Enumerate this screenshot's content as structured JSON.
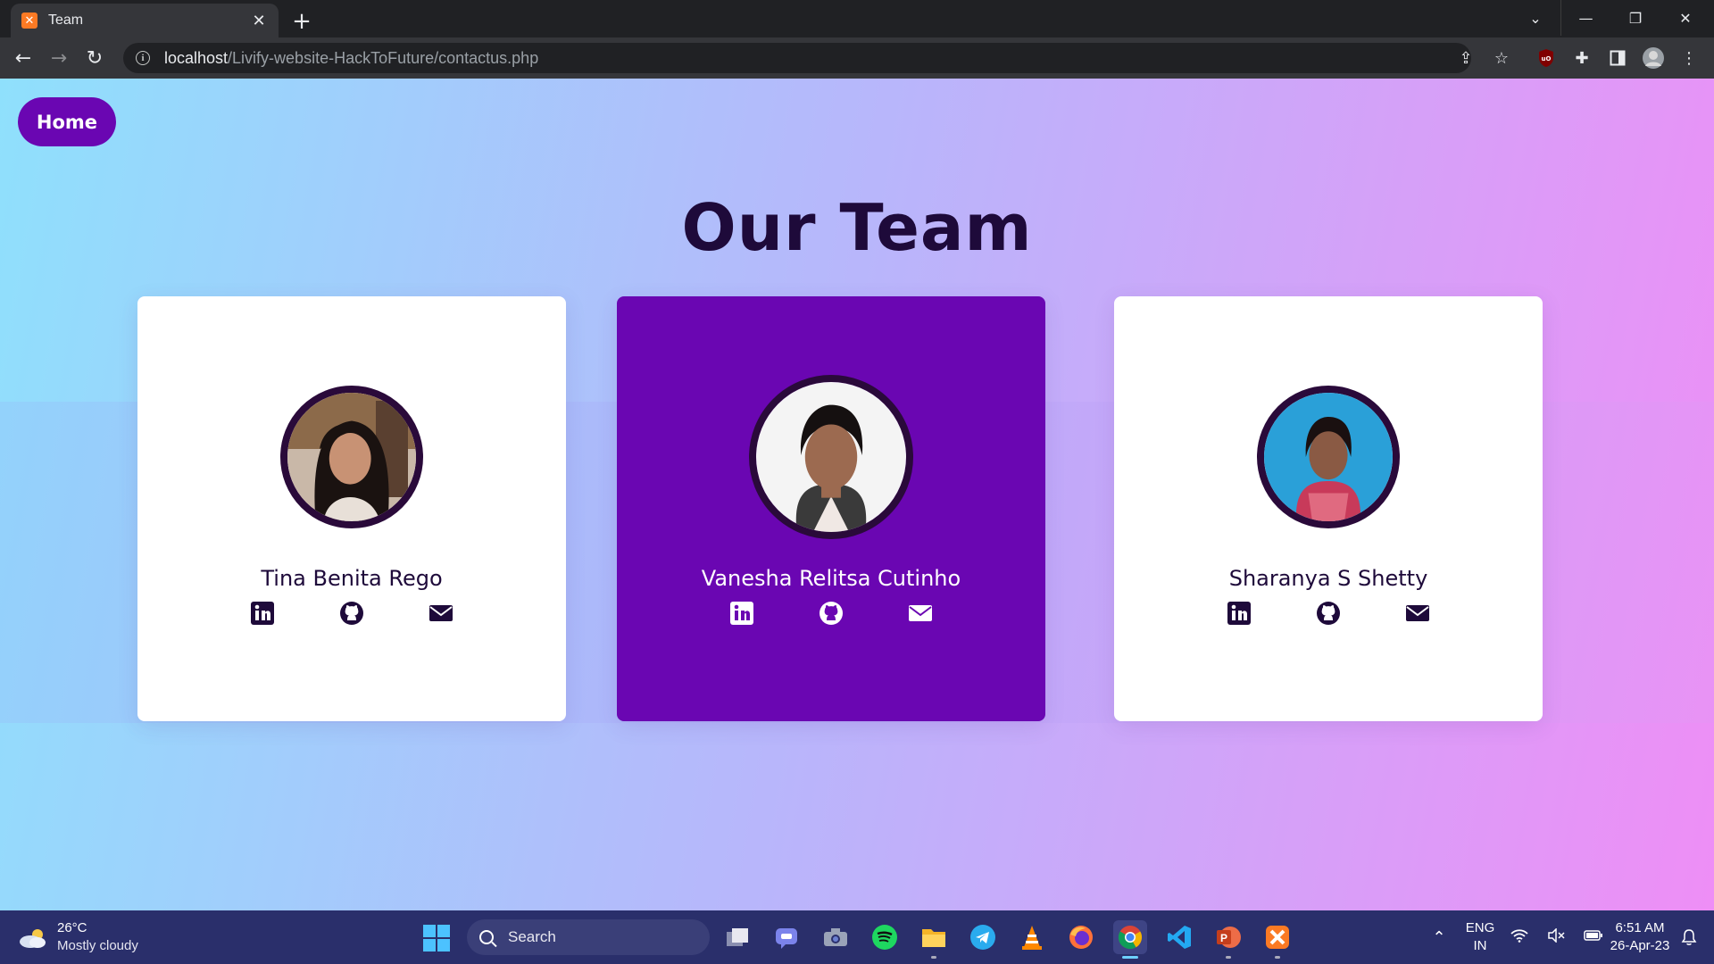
{
  "browser": {
    "tab_title": "Team",
    "url_host": "localhost",
    "url_path": "/Livify-website-HackToFuture/contactus.php"
  },
  "page": {
    "home_label": "Home",
    "title": "Our Team",
    "members": [
      {
        "name": "Tina Benita Rego",
        "featured": false
      },
      {
        "name": "Vanesha Relitsa Cutinho",
        "featured": true
      },
      {
        "name": "Sharanya S Shetty",
        "featured": false
      }
    ],
    "colors": {
      "accent": "#6a06b2",
      "dark": "#1e0a3a",
      "card": "#ffffff"
    }
  },
  "taskbar": {
    "weather_temp": "26°C",
    "weather_cond": "Mostly cloudy",
    "search_label": "Search",
    "lang_top": "ENG",
    "lang_bottom": "IN",
    "time": "6:51 AM",
    "date": "26-Apr-23"
  }
}
